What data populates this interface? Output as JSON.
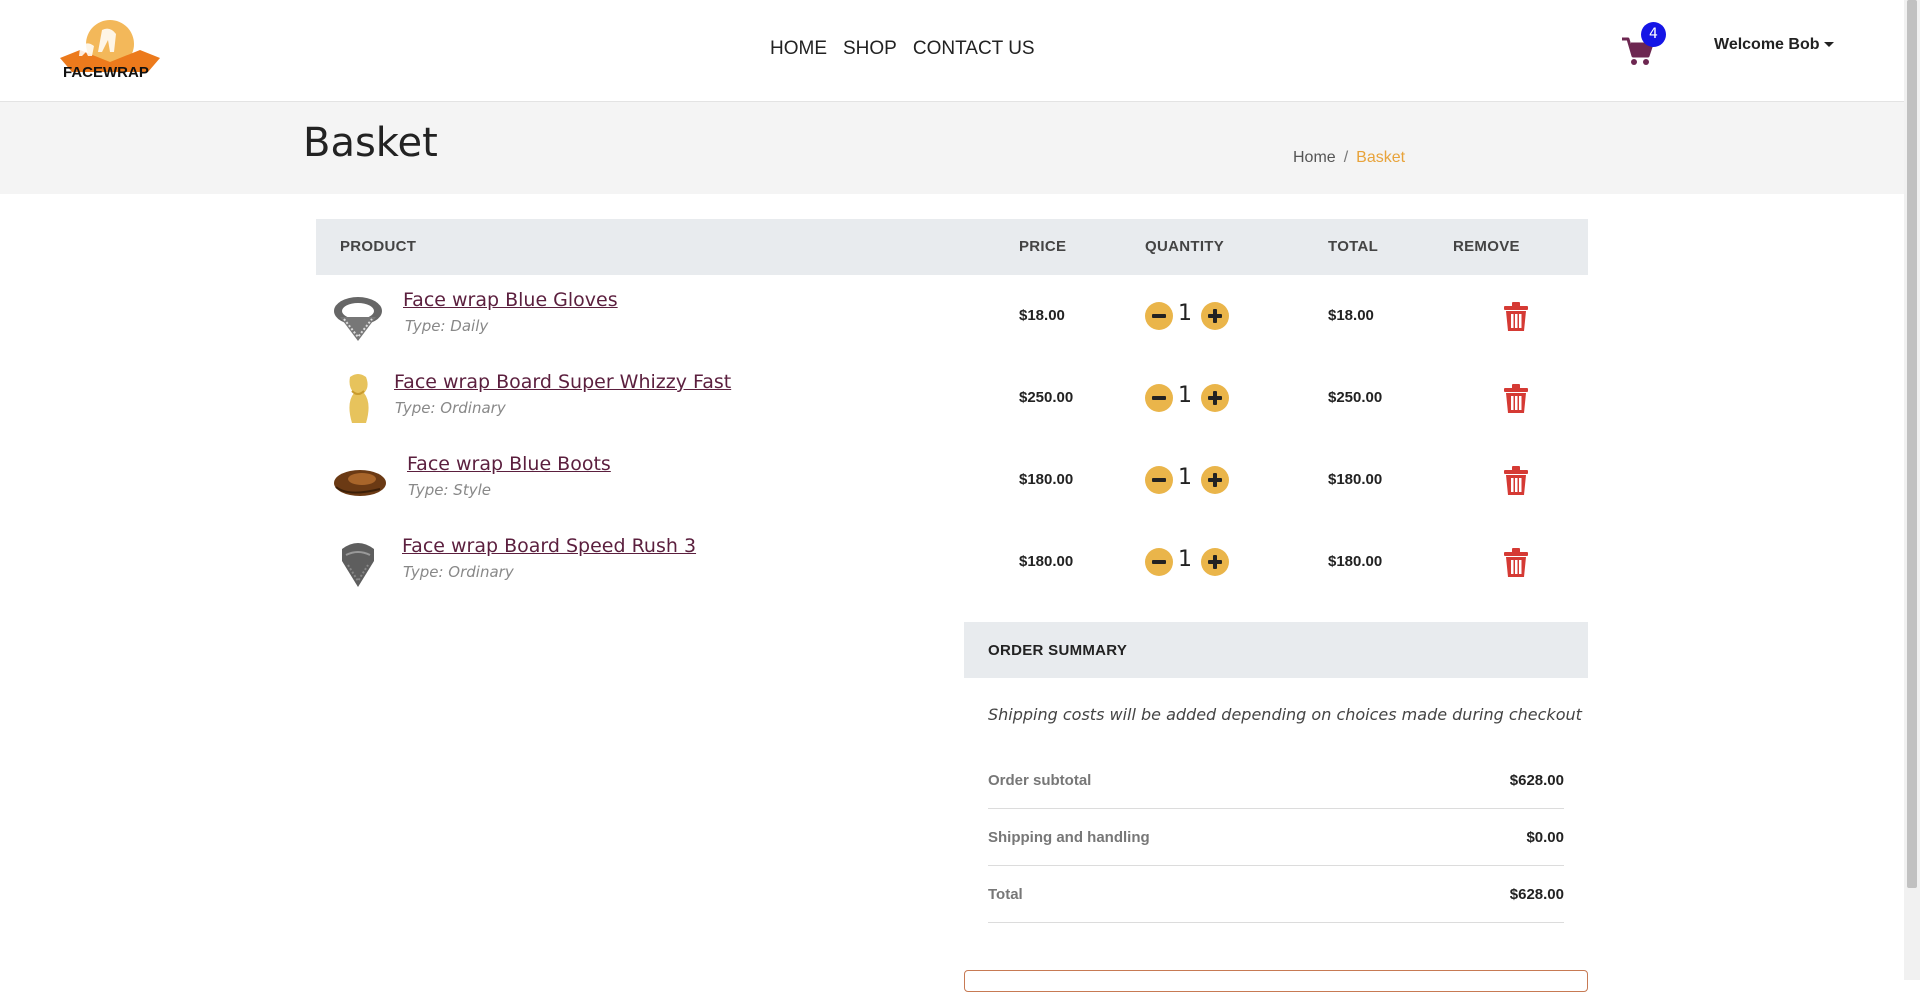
{
  "brand": {
    "logo_text": "FACEWRAP",
    "accent_color": "#e8a33a",
    "link_color": "#5b1f3e"
  },
  "nav": {
    "items": [
      "HOME",
      "SHOP",
      "CONTACT US"
    ]
  },
  "cart": {
    "icon": "shopping-cart-icon",
    "count": "4"
  },
  "user": {
    "welcome": "Welcome Bob"
  },
  "page": {
    "title": "Basket"
  },
  "breadcrumb": {
    "home": "Home",
    "separator": "/",
    "current": "Basket"
  },
  "table": {
    "headers": {
      "product": "PRODUCT",
      "price": "PRICE",
      "quantity": "QUANTITY",
      "total": "TOTAL",
      "remove": "REMOVE"
    },
    "rows": [
      {
        "name": "Face wrap Blue Gloves",
        "type": "Type: Daily",
        "price": "$18.00",
        "qty": "1",
        "total": "$18.00",
        "image": "checkered-scarf-image"
      },
      {
        "name": "Face wrap Board Super Whizzy Fast",
        "type": "Type: Ordinary",
        "price": "$250.00",
        "qty": "1",
        "total": "$250.00",
        "image": "yellow-wrap-image"
      },
      {
        "name": "Face wrap Blue Boots",
        "type": "Type: Style",
        "price": "$180.00",
        "qty": "1",
        "total": "$180.00",
        "image": "brown-wrap-image"
      },
      {
        "name": "Face wrap Board Speed Rush 3",
        "type": "Type: Ordinary",
        "price": "$180.00",
        "qty": "1",
        "total": "$180.00",
        "image": "grey-scarf-image"
      }
    ]
  },
  "summary": {
    "title": "ORDER SUMMARY",
    "note": "Shipping costs will be added depending on choices made during checkout",
    "rows": [
      {
        "label": "Order subtotal",
        "value": "$628.00"
      },
      {
        "label": "Shipping and handling",
        "value": "$0.00"
      },
      {
        "label": "Total",
        "value": "$628.00"
      }
    ]
  }
}
